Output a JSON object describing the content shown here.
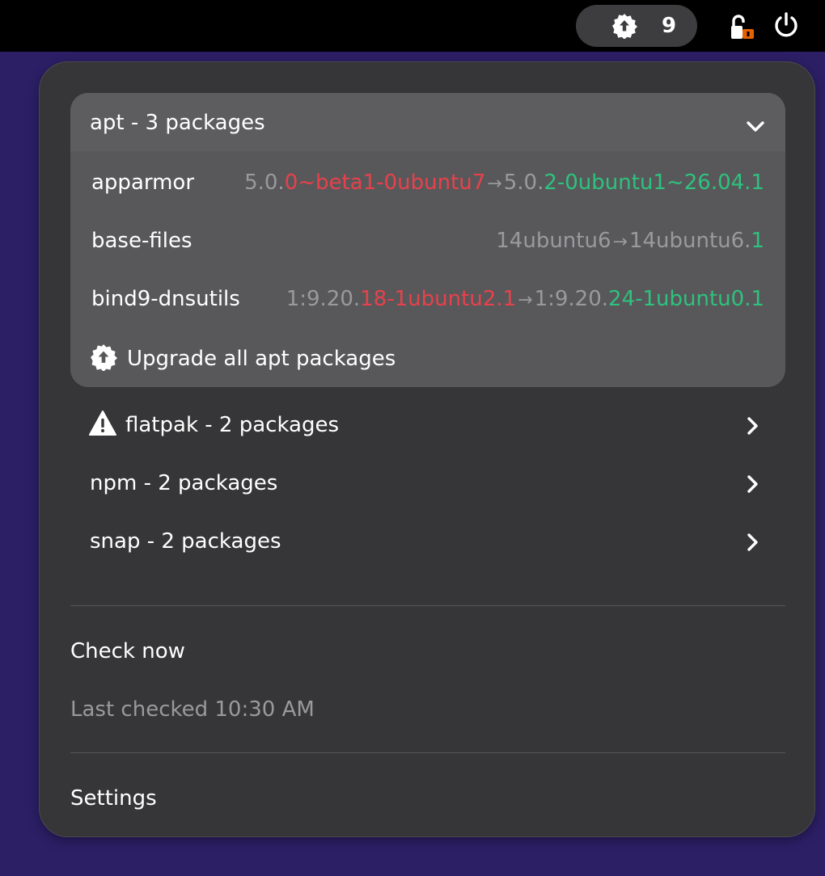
{
  "topbar": {
    "updates_count": "9",
    "icons": {
      "updates": "software-update-icon",
      "lock": "unlocked-padlock-icon",
      "power": "power-icon"
    },
    "accent_lock": "#e66100"
  },
  "apt": {
    "title": "apt - 3 packages",
    "packages": [
      {
        "name": "apparmor",
        "old_common": "5.0.",
        "old_diff": "0~beta1-0ubuntu7",
        "new_common": "5.0.",
        "new_diff": "2-0ubuntu1~26.04.1"
      },
      {
        "name": "base-files",
        "old_common": "14ubuntu6",
        "old_diff": "",
        "new_common": "14ubuntu6.",
        "new_diff": "1"
      },
      {
        "name": "bind9-dnsutils",
        "old_common": "1:9.20.",
        "old_diff": "18-1ubuntu2.1",
        "new_common": "1:9.20.",
        "new_diff": "24-1ubuntu0.1"
      }
    ],
    "arrow": "→",
    "upgrade_all_label": "Upgrade all apt packages"
  },
  "sources": [
    {
      "label": "flatpak - 2 packages",
      "warning": true
    },
    {
      "label": "npm - 2 packages",
      "warning": false
    },
    {
      "label": "snap - 2 packages",
      "warning": false
    }
  ],
  "menu": {
    "check_now": "Check now",
    "last_checked": "Last checked 10:30 AM",
    "settings": "Settings"
  },
  "colors": {
    "old_version": "#e8414b",
    "new_version": "#2ec27e",
    "muted": "#9a9a9d"
  }
}
